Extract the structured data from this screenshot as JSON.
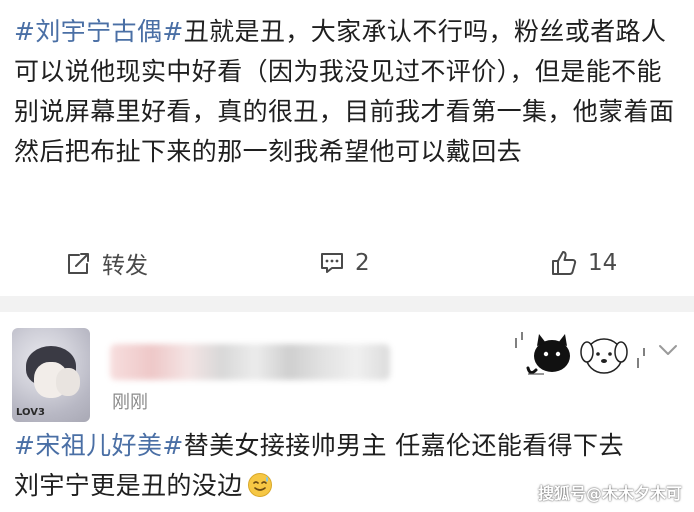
{
  "post1": {
    "topic": "#刘宇宁古偶#",
    "body": "丑就是丑，大家承认不行吗，粉丝或者路人可以说他现实中好看（因为我没见过不评价），但是能不能别说屏幕里好看，真的很丑，目前我才看第一集，他蒙着面然后把布扯下来的那一刻我希望他可以戴回去",
    "actions": {
      "repost_label": "转发",
      "comment_count": "2",
      "like_count": "14"
    }
  },
  "post2": {
    "avatar_tag": "LOV3",
    "time": "刚刚",
    "topic": "#宋祖儿好美#",
    "body_line1": "替美女接接帅男主 任嘉伦还能看得下去",
    "body_line2": "刘宇宁更是丑的没边",
    "emoji": "sweat-smile-emoji"
  },
  "watermark": "搜狐号@木木夕木可",
  "colors": {
    "topic": "#4a6fa5",
    "text": "#1f1f1f",
    "meta": "#8a8a8a",
    "band": "#f2f2f2"
  }
}
